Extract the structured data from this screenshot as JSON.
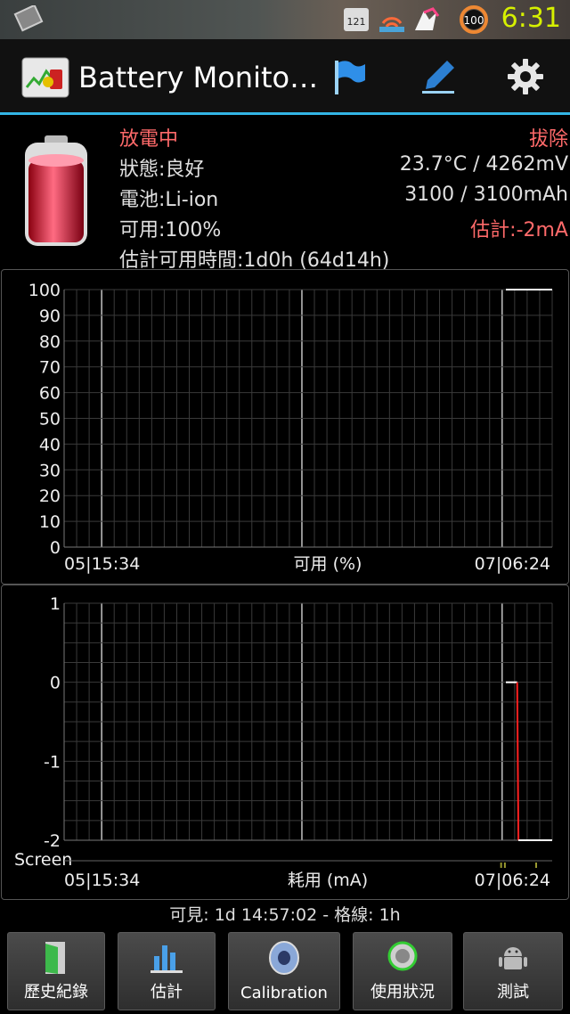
{
  "status_bar": {
    "time": "6:31",
    "battery_level": "100",
    "widget_text": "121"
  },
  "action_bar": {
    "title": "Battery Monito…"
  },
  "info": {
    "state": "放電中",
    "plug": "拔除",
    "health": "狀態:良好",
    "temp_voltage": "23.7°C / 4262mV",
    "chemistry": "電池:Li-ion",
    "capacity": "3100 / 3100mAh",
    "available": "可用:100%",
    "estimate_current": "估計:-2mA",
    "estimated_time": "估計可用時間:1d0h (64d14h)"
  },
  "chart_data": [
    {
      "type": "line",
      "xlabel": "可用 (%)",
      "x_start_label": "05|15:34",
      "x_end_label": "07|06:24",
      "yticks": [
        "100",
        "90",
        "80",
        "70",
        "60",
        "50",
        "40",
        "30",
        "20",
        "10",
        "0"
      ],
      "ylim": [
        0,
        100
      ],
      "grid": true,
      "x_range_hours": [
        0,
        39
      ],
      "series": [
        {
          "color": "#ffffff",
          "points": [
            [
              35.3,
              100
            ],
            [
              39,
              100
            ]
          ]
        }
      ]
    },
    {
      "type": "line",
      "xlabel": "耗用 (mA)",
      "x_start_label": "05|15:34",
      "x_end_label": "07|06:24",
      "yticks": [
        "1",
        "0",
        "-1",
        "-2"
      ],
      "ylim": [
        -2,
        1
      ],
      "grid": true,
      "x_range_hours": [
        0,
        39
      ],
      "screen_label": "Screen",
      "series": [
        {
          "color": "#ffffff",
          "points": [
            [
              35.3,
              0
            ],
            [
              36.2,
              0
            ]
          ]
        },
        {
          "color": "#ff2020",
          "points": [
            [
              36.2,
              0
            ],
            [
              36.3,
              -2
            ]
          ]
        },
        {
          "color": "#ffffff",
          "points": [
            [
              36.3,
              -2
            ],
            [
              39,
              -2
            ]
          ]
        }
      ]
    }
  ],
  "footer": {
    "visible_range": "可見: 1d 14:57:02 - 格線: 1h"
  },
  "bottom_bar": {
    "history": "歷史紀錄",
    "estimate": "估計",
    "calibration": "Calibration",
    "usage": "使用狀況",
    "test": "測試"
  },
  "colors": {
    "accent": "#33b5e5",
    "alert": "#ff6a6a",
    "clock": "#d6f000"
  }
}
